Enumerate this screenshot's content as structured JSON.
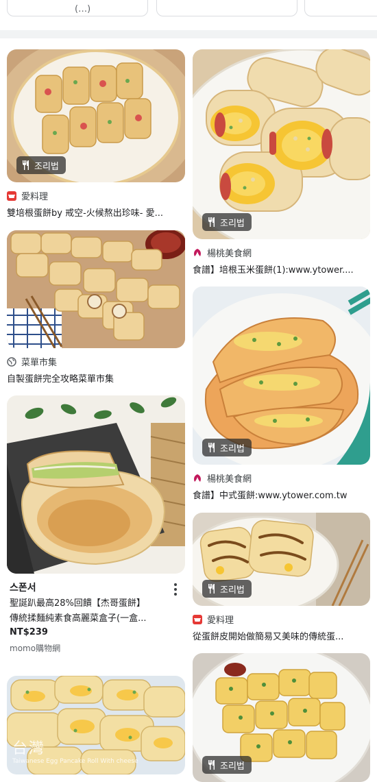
{
  "chips": {
    "chip1_label": "(…)"
  },
  "badge_label": "조리법",
  "colors": {
    "aiyaoli": "#e53935",
    "ytower": "#c2185b",
    "caidan": "#5f6368",
    "badge_bg": "#3a3a3a"
  },
  "results": [
    {
      "source": "愛料理",
      "title": "雙培根蛋餅by 戒空-火候熬出珍味- 愛...",
      "favicon": "pot-icon",
      "has_badge": true
    },
    {
      "source": "楊桃美食網",
      "title": "食譜】培根玉米蛋餅(1):www.ytower....",
      "favicon": "ytower-logo-icon",
      "has_badge": true
    },
    {
      "source": "菜單市集",
      "title": "自製蛋餅完全攻略菜單市集",
      "favicon": "globe-icon",
      "has_badge": false
    },
    {
      "source": "楊桃美食網",
      "title": "食譜】中式蛋餅:www.ytower.com.tw",
      "favicon": "ytower-logo-icon",
      "has_badge": true
    },
    {
      "source": "愛料理",
      "title": "從蛋餅皮開始做簡易又美味的傳統蛋...",
      "favicon": "pot-icon",
      "has_badge": true
    },
    {
      "source": "",
      "title": "",
      "favicon": "",
      "has_badge": true
    }
  ],
  "product": {
    "brand": "스폰서",
    "title_line1": "聖誕趴最高28%回饋【杰哥蛋餅】",
    "title_line2": "傳統揉麵純素食高麗菜盒子(一盒...",
    "price": "NT$239",
    "store": "momo購物網"
  },
  "watermark": {
    "text": "台灣",
    "sub": "Taiwanese Egg Pancake Roll With cheese"
  }
}
